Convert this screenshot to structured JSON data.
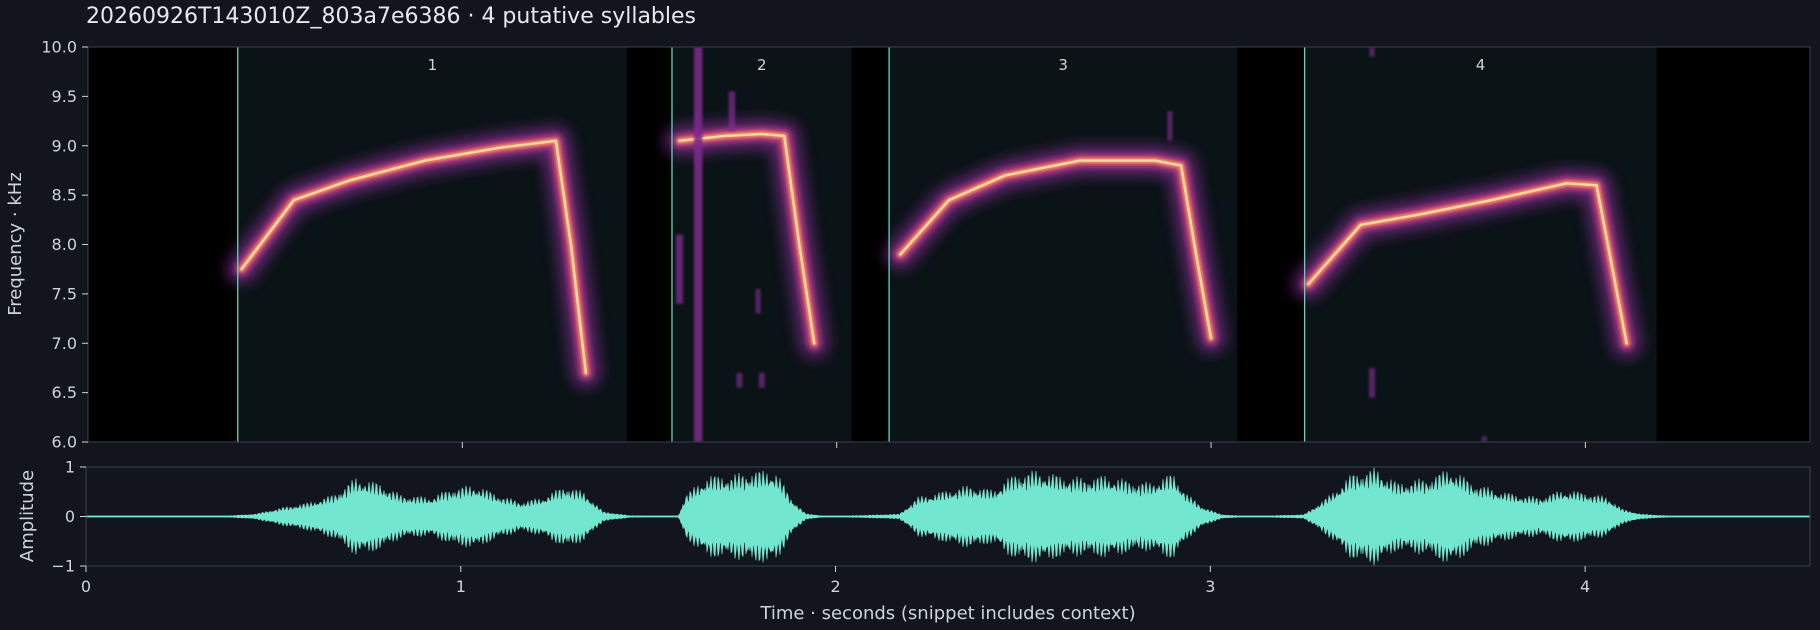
{
  "title": "20260926T143010Z_803a7e6386  ·  4 putative syllables",
  "colors": {
    "background": "#12151e",
    "spectrogram_bg": "#000000",
    "syllable_region": "#0a1316",
    "onset_line": "#5fd6b4",
    "waveform": "#72e6cf",
    "spectral_ridge": "#ffd8a8",
    "spectral_halo": "#7b2c8a"
  },
  "chart_data": [
    {
      "type": "heatmap",
      "name": "spectrogram",
      "ylabel": "Frequency · kHz",
      "xlim": [
        0,
        4.6
      ],
      "ylim": [
        6.0,
        10.0
      ],
      "yticks": [
        "6.0",
        "6.5",
        "7.0",
        "7.5",
        "8.0",
        "8.5",
        "9.0",
        "9.5",
        "10.0"
      ],
      "syllables": [
        {
          "label": "1",
          "onset": 0.4,
          "offset": 1.44,
          "contour": [
            [
              0.41,
              7.75
            ],
            [
              0.55,
              8.45
            ],
            [
              0.7,
              8.65
            ],
            [
              0.9,
              8.85
            ],
            [
              1.1,
              8.98
            ],
            [
              1.25,
              9.05
            ],
            [
              1.29,
              8.0
            ],
            [
              1.33,
              6.7
            ]
          ]
        },
        {
          "label": "2",
          "onset": 1.56,
          "offset": 2.04,
          "contour": [
            [
              1.58,
              9.05
            ],
            [
              1.7,
              9.1
            ],
            [
              1.8,
              9.12
            ],
            [
              1.86,
              9.1
            ],
            [
              1.9,
              8.0
            ],
            [
              1.94,
              7.0
            ]
          ]
        },
        {
          "label": "3",
          "onset": 2.14,
          "offset": 3.07,
          "contour": [
            [
              2.17,
              7.9
            ],
            [
              2.3,
              8.45
            ],
            [
              2.45,
              8.7
            ],
            [
              2.65,
              8.85
            ],
            [
              2.85,
              8.85
            ],
            [
              2.92,
              8.8
            ],
            [
              2.96,
              7.9
            ],
            [
              3.0,
              7.05
            ]
          ]
        },
        {
          "label": "4",
          "onset": 3.25,
          "offset": 4.19,
          "contour": [
            [
              3.26,
              7.6
            ],
            [
              3.4,
              8.2
            ],
            [
              3.55,
              8.3
            ],
            [
              3.75,
              8.45
            ],
            [
              3.95,
              8.62
            ],
            [
              4.03,
              8.6
            ],
            [
              4.07,
              7.8
            ],
            [
              4.11,
              7.0
            ]
          ]
        }
      ],
      "noise_segments": [
        {
          "x": 1.63,
          "y0": 6.0,
          "y1": 10.0,
          "strength": 0.9
        },
        {
          "x": 1.58,
          "y0": 7.4,
          "y1": 8.1,
          "strength": 0.7
        },
        {
          "x": 1.72,
          "y0": 9.15,
          "y1": 9.55,
          "strength": 0.6
        },
        {
          "x": 1.74,
          "y0": 6.55,
          "y1": 6.7,
          "strength": 0.5
        },
        {
          "x": 1.8,
          "y0": 6.55,
          "y1": 6.7,
          "strength": 0.5
        },
        {
          "x": 1.79,
          "y0": 7.3,
          "y1": 7.55,
          "strength": 0.4
        },
        {
          "x": 3.43,
          "y0": 6.45,
          "y1": 6.75,
          "strength": 0.5
        },
        {
          "x": 3.43,
          "y0": 9.9,
          "y1": 10.0,
          "strength": 0.4
        },
        {
          "x": 3.73,
          "y0": 6.0,
          "y1": 6.06,
          "strength": 0.4
        },
        {
          "x": 2.89,
          "y0": 9.05,
          "y1": 9.35,
          "strength": 0.4
        }
      ]
    },
    {
      "type": "area",
      "name": "waveform",
      "xlabel": "Time · seconds (snippet includes context)",
      "ylabel": "Amplitude",
      "xlim": [
        0,
        4.6
      ],
      "ylim": [
        -1,
        1
      ],
      "xticks": [
        0,
        1,
        2,
        3,
        4
      ],
      "xtick_labels": [
        "0",
        "1",
        "2",
        "3",
        "4"
      ],
      "yticks": [
        "1",
        "0",
        "−1"
      ],
      "envelope": [
        [
          0.0,
          0.0
        ],
        [
          0.35,
          0.0
        ],
        [
          0.45,
          0.05
        ],
        [
          0.52,
          0.18
        ],
        [
          0.6,
          0.3
        ],
        [
          0.66,
          0.45
        ],
        [
          0.72,
          0.8
        ],
        [
          0.78,
          0.7
        ],
        [
          0.84,
          0.45
        ],
        [
          0.92,
          0.4
        ],
        [
          0.98,
          0.6
        ],
        [
          1.04,
          0.65
        ],
        [
          1.1,
          0.45
        ],
        [
          1.16,
          0.3
        ],
        [
          1.22,
          0.4
        ],
        [
          1.28,
          0.65
        ],
        [
          1.33,
          0.5
        ],
        [
          1.38,
          0.1
        ],
        [
          1.45,
          0.02
        ],
        [
          1.58,
          0.0
        ],
        [
          1.6,
          0.45
        ],
        [
          1.66,
          0.85
        ],
        [
          1.72,
          0.85
        ],
        [
          1.78,
          0.95
        ],
        [
          1.84,
          0.95
        ],
        [
          1.88,
          0.4
        ],
        [
          1.92,
          0.06
        ],
        [
          1.98,
          0.0
        ],
        [
          2.17,
          0.05
        ],
        [
          2.22,
          0.4
        ],
        [
          2.3,
          0.55
        ],
        [
          2.36,
          0.65
        ],
        [
          2.42,
          0.55
        ],
        [
          2.48,
          0.9
        ],
        [
          2.54,
          0.95
        ],
        [
          2.6,
          0.85
        ],
        [
          2.66,
          0.8
        ],
        [
          2.72,
          0.85
        ],
        [
          2.78,
          0.75
        ],
        [
          2.84,
          0.7
        ],
        [
          2.9,
          0.9
        ],
        [
          2.94,
          0.45
        ],
        [
          2.98,
          0.2
        ],
        [
          3.03,
          0.04
        ],
        [
          3.1,
          0.0
        ],
        [
          3.25,
          0.04
        ],
        [
          3.32,
          0.45
        ],
        [
          3.38,
          0.9
        ],
        [
          3.44,
          1.0
        ],
        [
          3.5,
          0.7
        ],
        [
          3.58,
          0.8
        ],
        [
          3.64,
          1.0
        ],
        [
          3.7,
          0.7
        ],
        [
          3.76,
          0.55
        ],
        [
          3.82,
          0.45
        ],
        [
          3.88,
          0.4
        ],
        [
          3.94,
          0.55
        ],
        [
          4.0,
          0.5
        ],
        [
          4.06,
          0.4
        ],
        [
          4.1,
          0.15
        ],
        [
          4.15,
          0.05
        ],
        [
          4.25,
          0.0
        ],
        [
          4.6,
          0.0
        ]
      ]
    }
  ]
}
